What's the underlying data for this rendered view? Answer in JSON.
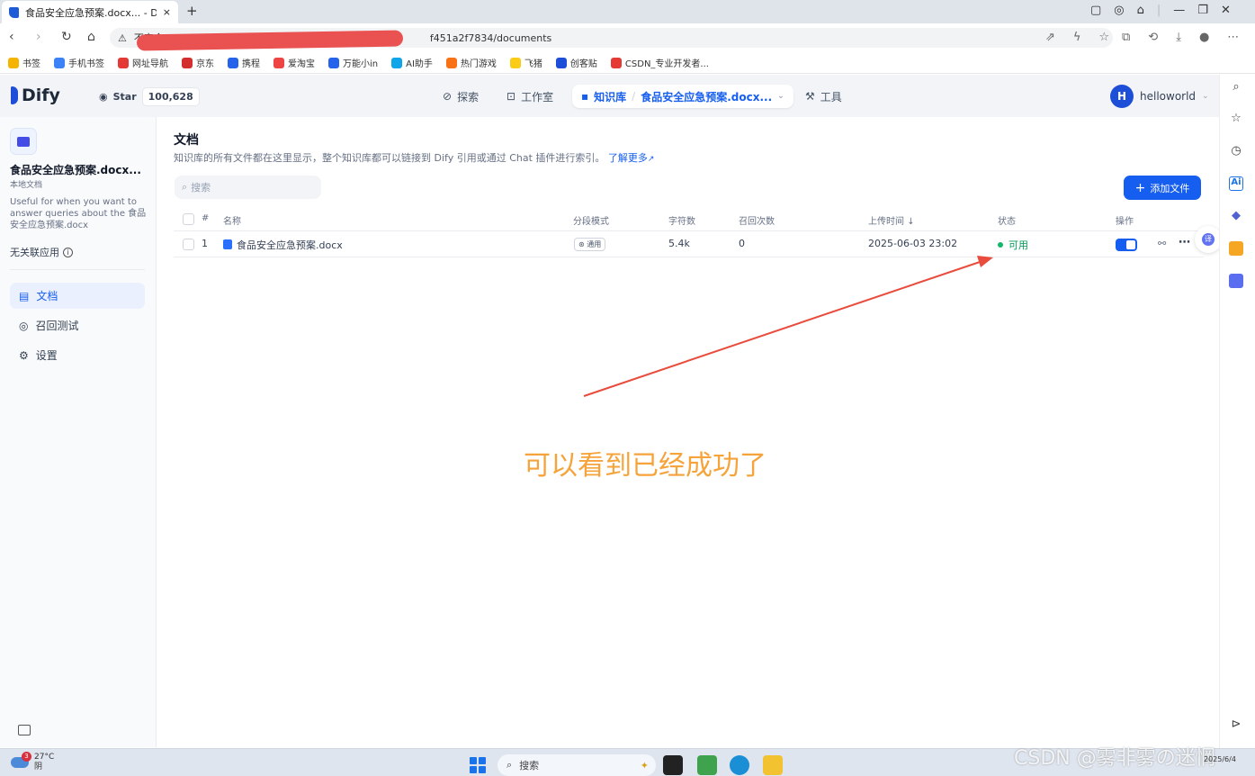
{
  "browser": {
    "tab_title": "食品安全应急预案.docx... - Dify",
    "tab_close": "×",
    "new_tab": "+",
    "url": "f451a2f7834/documents",
    "url_prefix": "不安全",
    "bookmarks": [
      {
        "label": "书签",
        "color": "#f5b400"
      },
      {
        "label": "手机书签",
        "color": "#3b82f6"
      },
      {
        "label": "网址导航",
        "color": "#e53935"
      },
      {
        "label": "京东",
        "color": "#d32f2f"
      },
      {
        "label": "携程",
        "color": "#2563eb"
      },
      {
        "label": "爱淘宝",
        "color": "#ef4444"
      },
      {
        "label": "万能小in",
        "color": "#2563eb"
      },
      {
        "label": "AI助手",
        "color": "#0ea5e9"
      },
      {
        "label": "热门游戏",
        "color": "#f97316"
      },
      {
        "label": "飞猪",
        "color": "#facc15"
      },
      {
        "label": "创客贴",
        "color": "#1d4ed8"
      },
      {
        "label": "CSDN_专业开发者...",
        "color": "#e53935"
      }
    ]
  },
  "header": {
    "brand": "Dify",
    "github_label": "Star",
    "github_count": "100,628",
    "nav_explore": "探索",
    "nav_studio": "工作室",
    "nav_knowledge": "知识库",
    "nav_breadcrumb_sep": "/",
    "nav_dataset": "食品安全应急预案.docx...",
    "nav_tools": "工具",
    "user_initial": "H",
    "user_name": "helloworld"
  },
  "sidebar": {
    "dataset_name": "食品安全应急预案.docx...",
    "dataset_type": "本地文档",
    "dataset_desc": "Useful for when you want to answer queries about the 食品安全应急预案.docx",
    "linked_apps": "无关联应用",
    "items": [
      {
        "label": "文档"
      },
      {
        "label": "召回测试"
      },
      {
        "label": "设置"
      }
    ]
  },
  "main": {
    "title": "文档",
    "desc": "知识库的所有文件都在这里显示，整个知识库都可以链接到 Dify 引用或通过 Chat 插件进行索引。",
    "learn_more": "了解更多",
    "search_placeholder": "搜索",
    "add_button": "添加文件",
    "columns": {
      "index": "#",
      "name": "名称",
      "mode": "分段模式",
      "chars": "字符数",
      "hits": "召回次数",
      "upload_time": "上传时间",
      "status": "状态",
      "actions": "操作"
    },
    "rows": [
      {
        "index": "1",
        "name": "食品安全应急预案.docx",
        "mode": "通用",
        "chars": "5.4k",
        "hits": "0",
        "upload_time": "2025-06-03 23:02",
        "status": "可用",
        "enabled": true
      }
    ]
  },
  "annotation": "可以看到已经成功了",
  "taskbar": {
    "temperature": "27°C",
    "weather": "阴",
    "weather_badge": "3",
    "search": "搜索",
    "date": "2025/6/4",
    "watermark": "CSDN @雾非雾の迷惘"
  }
}
